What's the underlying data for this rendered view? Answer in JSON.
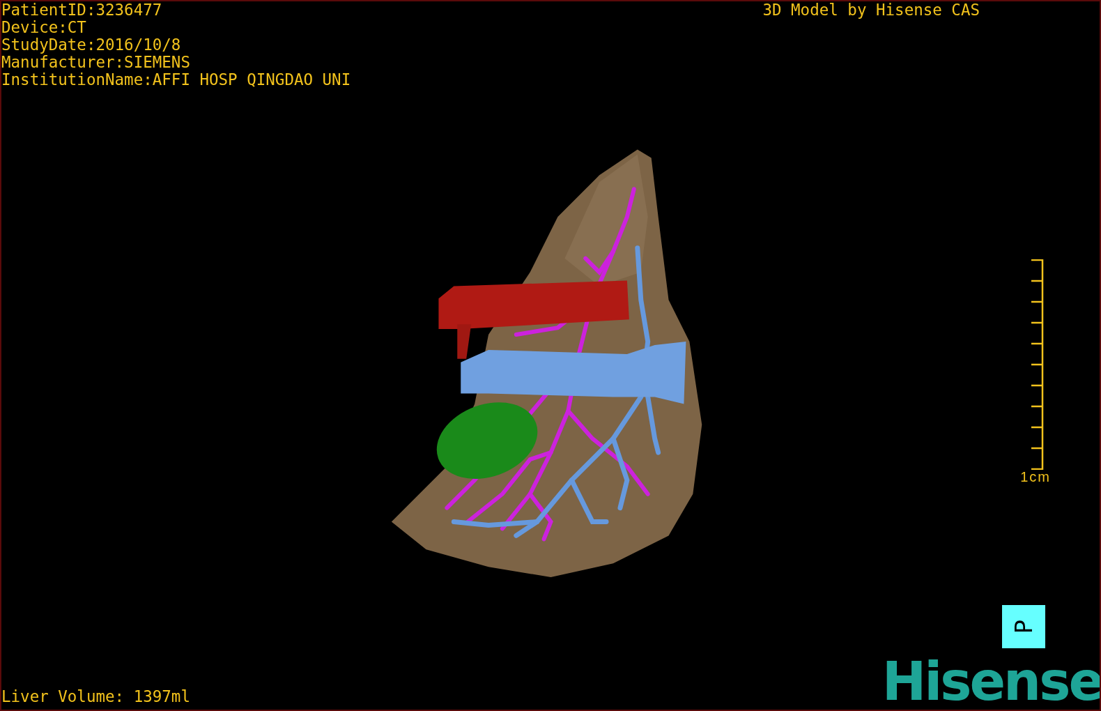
{
  "patient_info": [
    "PatientID:3236477",
    "Device:CT",
    "StudyDate:2016/10/8",
    "Manufacturer:SIEMENS",
    "InstitutionName:AFFI HOSP QINGDAO UNI"
  ],
  "title": "3D Model by Hisense CAS",
  "scale_bar": {
    "label": "1cm"
  },
  "liver_volume": "Liver Volume: 1397ml",
  "orientation_cube": {
    "label": "P"
  },
  "logo": "Hisense"
}
